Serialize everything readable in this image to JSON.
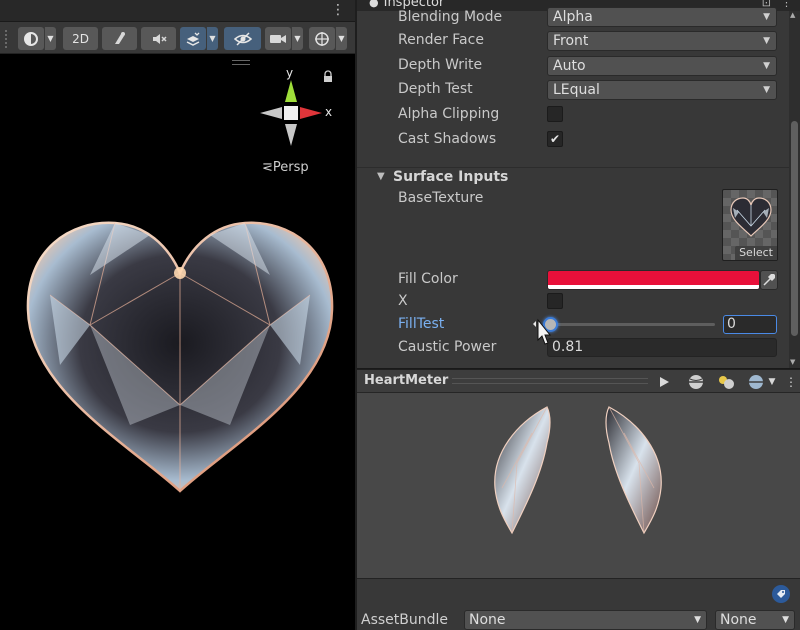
{
  "scene": {
    "toolbar": {
      "btn_2d": "2D"
    },
    "gizmo": {
      "axis_y": "y",
      "axis_x": "x",
      "projection": "Persp"
    }
  },
  "inspector": {
    "tab_title": "Inspector",
    "properties": {
      "blending_mode": {
        "label": "Blending Mode",
        "value": "Alpha"
      },
      "render_face": {
        "label": "Render Face",
        "value": "Front"
      },
      "depth_write": {
        "label": "Depth Write",
        "value": "Auto"
      },
      "depth_test": {
        "label": "Depth Test",
        "value": "LEqual"
      },
      "alpha_clipping": {
        "label": "Alpha Clipping",
        "checked": false
      },
      "cast_shadows": {
        "label": "Cast Shadows",
        "checked": true,
        "check_glyph": "✔"
      }
    },
    "surface_inputs": {
      "header": "Surface Inputs",
      "base_texture": {
        "label": "BaseTexture",
        "select": "Select"
      },
      "fill_color": {
        "label": "Fill Color",
        "color": "#e8103a"
      },
      "x": {
        "label": "X",
        "checked": false
      },
      "fill_test": {
        "label": "FillTest",
        "value": "0",
        "level": 0
      },
      "caustic_power": {
        "label": "Caustic Power",
        "value": "0.81"
      }
    }
  },
  "preview": {
    "title": "HeartMeter"
  },
  "footer": {
    "asset_bundle_label": "AssetBundle",
    "bundle_name": "None",
    "bundle_variant": "None"
  },
  "colors": {
    "accent": "#46607c",
    "focus": "#4a8ae6",
    "label_highlight": "#7ab0f0"
  },
  "icons": [
    "scene-mode-icon",
    "lighting-icon",
    "audio-icon",
    "effects-icon",
    "hidden-icon",
    "camera-icon",
    "gizmo-icon",
    "lock-icon",
    "play-icon",
    "sphere-icon",
    "light-icon",
    "options-icon",
    "tag-icon",
    "eyedropper-icon"
  ]
}
